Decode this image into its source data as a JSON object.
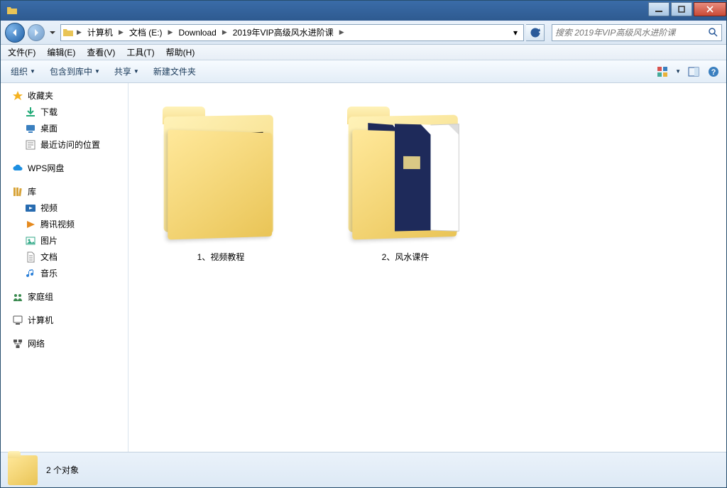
{
  "breadcrumb": [
    "计算机",
    "文档 (E:)",
    "Download",
    "2019年VIP高级风水进阶课"
  ],
  "search": {
    "placeholder": "搜索 2019年VIP高级风水进阶课"
  },
  "menu": {
    "file": "文件(F)",
    "edit": "编辑(E)",
    "view": "查看(V)",
    "tools": "工具(T)",
    "help": "帮助(H)"
  },
  "toolbar": {
    "organize": "组织",
    "include": "包含到库中",
    "share": "共享",
    "newfolder": "新建文件夹"
  },
  "sidebar": {
    "favorites": {
      "label": "收藏夹",
      "items": [
        "下载",
        "桌面",
        "最近访问的位置"
      ]
    },
    "wps": {
      "label": "WPS网盘"
    },
    "libraries": {
      "label": "库",
      "items": [
        "视频",
        "腾讯视频",
        "图片",
        "文档",
        "音乐"
      ]
    },
    "homegroup": {
      "label": "家庭组"
    },
    "computer": {
      "label": "计算机"
    },
    "network": {
      "label": "网络"
    }
  },
  "items": [
    {
      "name": "1、视频教程"
    },
    {
      "name": "2、风水课件"
    }
  ],
  "status": {
    "text": "2 个对象"
  }
}
